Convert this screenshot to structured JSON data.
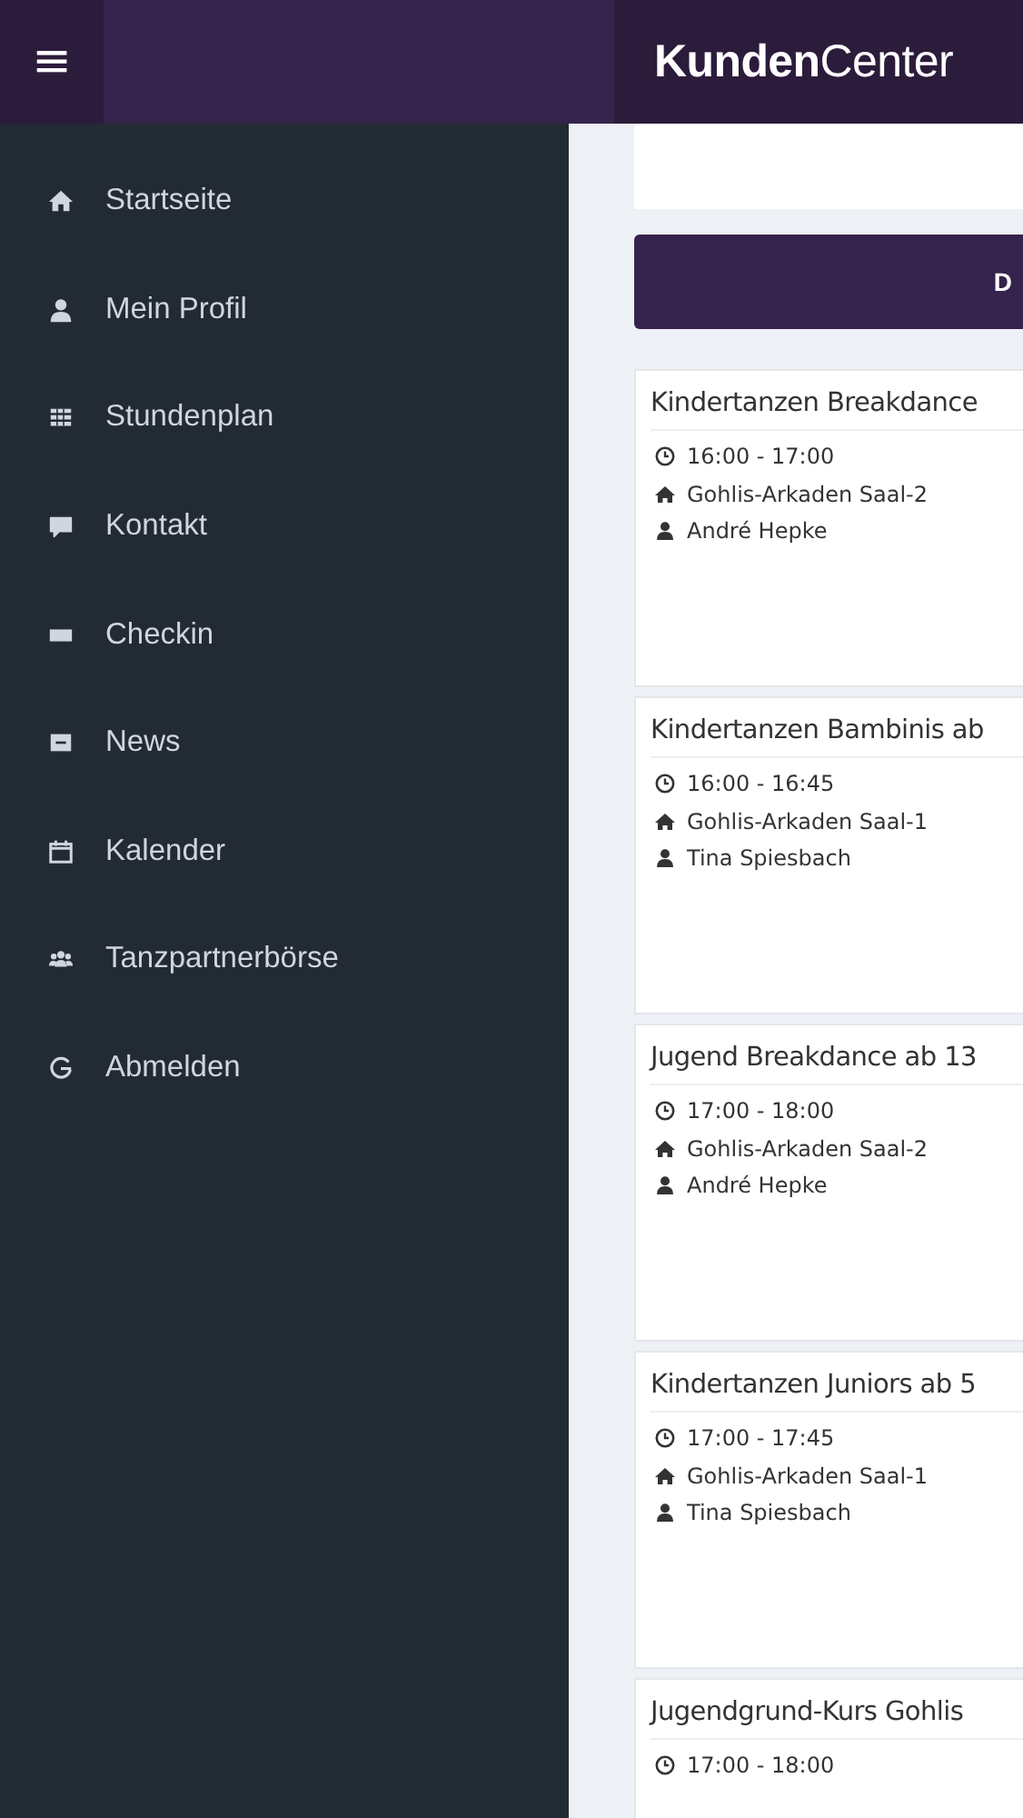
{
  "header": {
    "menu_icon": "≡",
    "logo_bold": "Kunden",
    "logo_regular": "Center"
  },
  "sidebar": {
    "items": [
      {
        "label": "Startseite"
      },
      {
        "label": "Mein Profil"
      },
      {
        "label": "Stundenplan"
      },
      {
        "label": "Kontakt"
      },
      {
        "label": "Checkin"
      },
      {
        "label": "News"
      },
      {
        "label": "Kalender"
      },
      {
        "label": "Tanzpartnerbörse"
      },
      {
        "label": "Abmelden"
      }
    ]
  },
  "day_bar": {
    "label": "D"
  },
  "courses": [
    {
      "title": "Kindertanzen Breakdance",
      "time": "16:00 - 17:00",
      "room": "Gohlis-Arkaden Saal-2",
      "teacher": "André Hepke"
    },
    {
      "title": "Kindertanzen Bambinis ab",
      "time": "16:00 - 16:45",
      "room": "Gohlis-Arkaden Saal-1",
      "teacher": "Tina Spiesbach"
    },
    {
      "title": "Jugend Breakdance ab 13",
      "time": "17:00 - 18:00",
      "room": "Gohlis-Arkaden Saal-2",
      "teacher": "André Hepke"
    },
    {
      "title": "Kindertanzen Juniors ab 5",
      "time": "17:00 - 17:45",
      "room": "Gohlis-Arkaden Saal-1",
      "teacher": "Tina Spiesbach"
    },
    {
      "title": "Jugendgrund-Kurs Gohlis",
      "time": "17:00 - 18:00"
    }
  ]
}
